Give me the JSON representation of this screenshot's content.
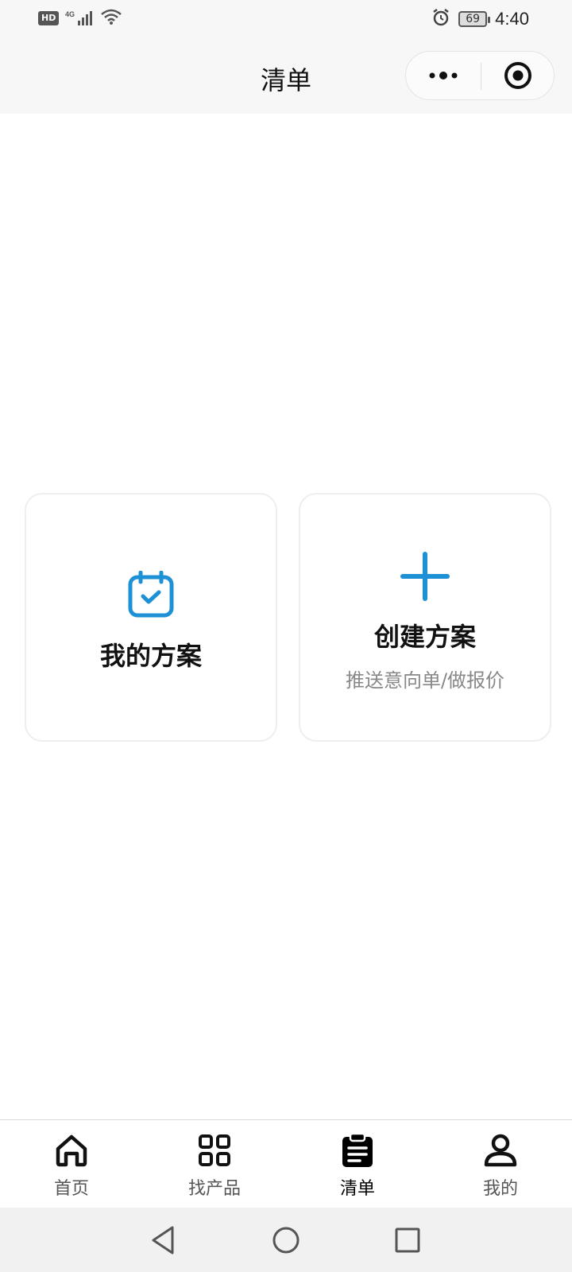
{
  "status_bar": {
    "hd": "HD",
    "network": "4G",
    "battery": "69",
    "time": "4:40"
  },
  "nav": {
    "title": "清单"
  },
  "cards": [
    {
      "title": "我的方案",
      "icon": "calendar-check-icon"
    },
    {
      "title": "创建方案",
      "subtitle": "推送意向单/做报价",
      "icon": "plus-icon"
    }
  ],
  "tabs": [
    {
      "label": "首页",
      "icon": "home-icon"
    },
    {
      "label": "找产品",
      "icon": "grid-icon"
    },
    {
      "label": "清单",
      "icon": "clipboard-icon",
      "active": true
    },
    {
      "label": "我的",
      "icon": "user-icon"
    }
  ],
  "colors": {
    "accent": "#1e90d6",
    "status_bar_bg": "#f7f7f7",
    "tab_active": "#000000",
    "tab_inactive": "#555555"
  }
}
